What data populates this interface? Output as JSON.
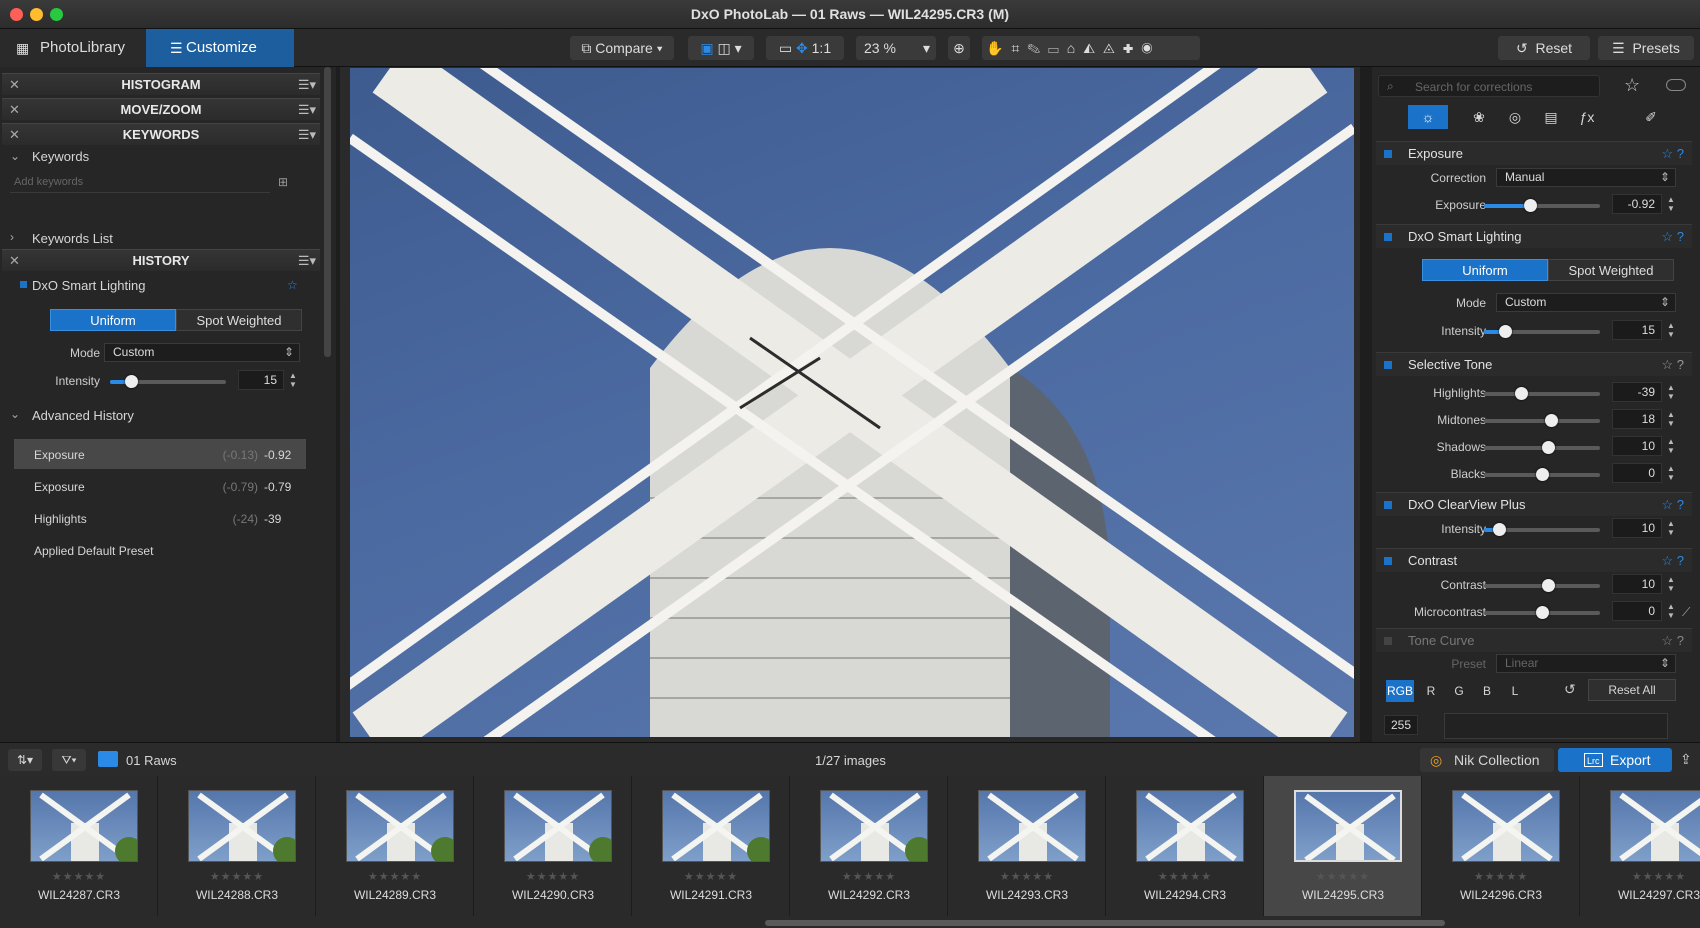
{
  "window": {
    "title": "DxO PhotoLab — 01 Raws — WIL24295.CR3 (M)"
  },
  "tabs": {
    "photolibrary": "PhotoLibrary",
    "customize": "Customize"
  },
  "toolbar": {
    "compare": "Compare",
    "one_to_one": "1:1",
    "zoom": "23 %",
    "reset": "Reset",
    "presets": "Presets"
  },
  "left": {
    "histogram": "HISTOGRAM",
    "movezoom": "MOVE/ZOOM",
    "keywords_head": "KEYWORDS",
    "keywords": "Keywords",
    "add_keywords_placeholder": "Add keywords",
    "keywords_list": "Keywords List",
    "history_head": "HISTORY",
    "smart_lighting": "DxO Smart Lighting",
    "uniform": "Uniform",
    "spot_weighted": "Spot Weighted",
    "mode_label": "Mode",
    "mode_value": "Custom",
    "intensity_label": "Intensity",
    "intensity_value": "15",
    "intensity_level": 0.18,
    "advanced_history": "Advanced History",
    "history_items": [
      {
        "name": "Exposure",
        "prev": "(-0.13)",
        "value": "-0.92"
      },
      {
        "name": "Exposure",
        "prev": "(-0.79)",
        "value": "-0.79"
      },
      {
        "name": "Highlights",
        "prev": "(-24)",
        "value": "-39"
      },
      {
        "name": "Applied Default Preset",
        "prev": "",
        "value": ""
      }
    ]
  },
  "right": {
    "search_placeholder": "Search for corrections",
    "exposure_head": "Exposure",
    "correction_label": "Correction",
    "correction_value": "Manual",
    "exposure_label": "Exposure",
    "exposure_value": "-0.92",
    "exposure_level": 0.4,
    "smart_lighting_head": "DxO Smart Lighting",
    "uniform": "Uniform",
    "spot_weighted": "Spot Weighted",
    "mode_label": "Mode",
    "mode_value": "Custom",
    "intensity_label": "Intensity",
    "intensity_value": "15",
    "intensity_level": 0.18,
    "selective_tone_head": "Selective Tone",
    "tones": [
      {
        "label": "Highlights",
        "value": "-39",
        "level": 0.32
      },
      {
        "label": "Midtones",
        "value": "18",
        "level": 0.58
      },
      {
        "label": "Shadows",
        "value": "10",
        "level": 0.55
      },
      {
        "label": "Blacks",
        "value": "0",
        "level": 0.5
      }
    ],
    "clearview_head": "DxO ClearView Plus",
    "clearview_intensity_label": "Intensity",
    "clearview_intensity_value": "10",
    "clearview_level": 0.13,
    "contrast_head": "Contrast",
    "contrast_label": "Contrast",
    "contrast_value": "10",
    "contrast_level": 0.55,
    "microcontrast_label": "Microcontrast",
    "microcontrast_value": "0",
    "microcontrast_level": 0.5,
    "tonecurve_head": "Tone Curve",
    "preset_label": "Preset",
    "preset_value": "Linear",
    "channels": [
      "RGB",
      "R",
      "G",
      "B",
      "L"
    ],
    "reset_all": "Reset All",
    "curve_max": "255"
  },
  "bottom": {
    "folder": "01 Raws",
    "count": "1/27 images",
    "nik": "Nik Collection",
    "export": "Export",
    "lrc": "Lrc"
  },
  "film": [
    {
      "name": "WIL24287.CR3",
      "selected": false
    },
    {
      "name": "WIL24288.CR3",
      "selected": false
    },
    {
      "name": "WIL24289.CR3",
      "selected": false
    },
    {
      "name": "WIL24290.CR3",
      "selected": false
    },
    {
      "name": "WIL24291.CR3",
      "selected": false
    },
    {
      "name": "WIL24292.CR3",
      "selected": false
    },
    {
      "name": "WIL24293.CR3",
      "selected": false
    },
    {
      "name": "WIL24294.CR3",
      "selected": false
    },
    {
      "name": "WIL24295.CR3",
      "selected": true
    },
    {
      "name": "WIL24296.CR3",
      "selected": false
    },
    {
      "name": "WIL24297.CR3",
      "selected": false
    }
  ],
  "stars": "★★★★★",
  "colors": {
    "accent": "#1a73c8",
    "sky": "#4b6aa1"
  }
}
